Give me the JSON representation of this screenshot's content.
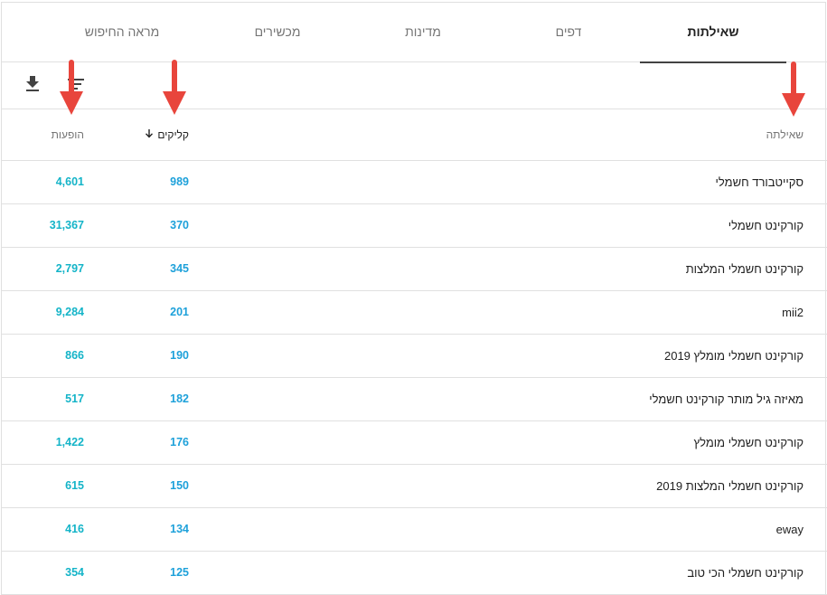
{
  "tabs": [
    {
      "label": "שאילתות",
      "active": true
    },
    {
      "label": "דפים",
      "active": false
    },
    {
      "label": "מדינות",
      "active": false
    },
    {
      "label": "מכשירים",
      "active": false
    },
    {
      "label": "מראה החיפוש",
      "active": false
    }
  ],
  "toolbar": {
    "download_icon": "download-icon",
    "filter_icon": "filter-icon"
  },
  "table": {
    "headers": {
      "query": "שאילתה",
      "clicks": "קליקים",
      "impressions": "הופעות"
    },
    "sorted_by": "clicks",
    "sort_direction": "descending",
    "rows": [
      {
        "query": "סקייטבורד חשמלי",
        "clicks": "989",
        "impressions": "4,601"
      },
      {
        "query": "קורקינט חשמלי",
        "clicks": "370",
        "impressions": "31,367"
      },
      {
        "query": "קורקינט חשמלי המלצות",
        "clicks": "345",
        "impressions": "2,797"
      },
      {
        "query": "mii2",
        "clicks": "201",
        "impressions": "9,284"
      },
      {
        "query": "קורקינט חשמלי מומלץ 2019",
        "clicks": "190",
        "impressions": "866"
      },
      {
        "query": "מאיזה גיל מותר קורקינט חשמלי",
        "clicks": "182",
        "impressions": "517"
      },
      {
        "query": "קורקינט חשמלי מומלץ",
        "clicks": "176",
        "impressions": "1,422"
      },
      {
        "query": "קורקינט חשמלי המלצות 2019",
        "clicks": "150",
        "impressions": "615"
      },
      {
        "query": "eway",
        "clicks": "134",
        "impressions": "416"
      },
      {
        "query": "קורקינט חשמלי הכי טוב",
        "clicks": "125",
        "impressions": "354"
      }
    ]
  },
  "colors": {
    "clicks": "#1ea1da",
    "impressions": "#14b4c8",
    "annotation_arrow": "#e8453c"
  }
}
